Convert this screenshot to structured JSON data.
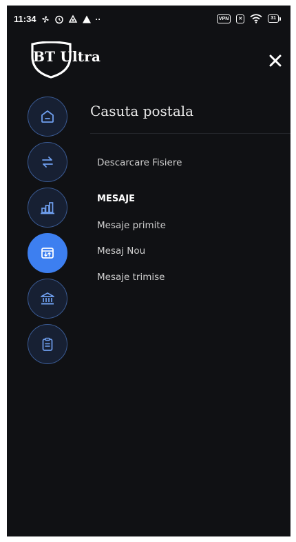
{
  "status_bar": {
    "time": "11:34",
    "overflow": "··",
    "icons": [
      "fan-icon",
      "alarm-icon",
      "recycle-icon",
      "warning-icon"
    ],
    "vpn_label": "VPN",
    "sim_label": "✕",
    "battery_label": "31"
  },
  "header": {
    "logo_text": "BT Ultra",
    "close_icon": "close-icon"
  },
  "nav": {
    "items": [
      {
        "name": "home",
        "icon": "home-icon",
        "active": false
      },
      {
        "name": "transfers",
        "icon": "transfer-arrows-icon",
        "active": false
      },
      {
        "name": "reports",
        "icon": "bar-chart-icon",
        "active": false
      },
      {
        "name": "mailbox",
        "icon": "mailbox-icon",
        "active": true
      },
      {
        "name": "bank",
        "icon": "bank-icon",
        "active": false
      },
      {
        "name": "documents",
        "icon": "clipboard-icon",
        "active": false
      }
    ],
    "accent_color": "#3d7ff0",
    "ring_color": "#3a5a93"
  },
  "panel": {
    "title": "Casuta postala",
    "download_files": "Descarcare Fisiere",
    "section_messages": "MESAJE",
    "received_messages": "Mesaje primite",
    "new_message": "Mesaj Nou",
    "sent_messages": "Mesaje trimise"
  }
}
